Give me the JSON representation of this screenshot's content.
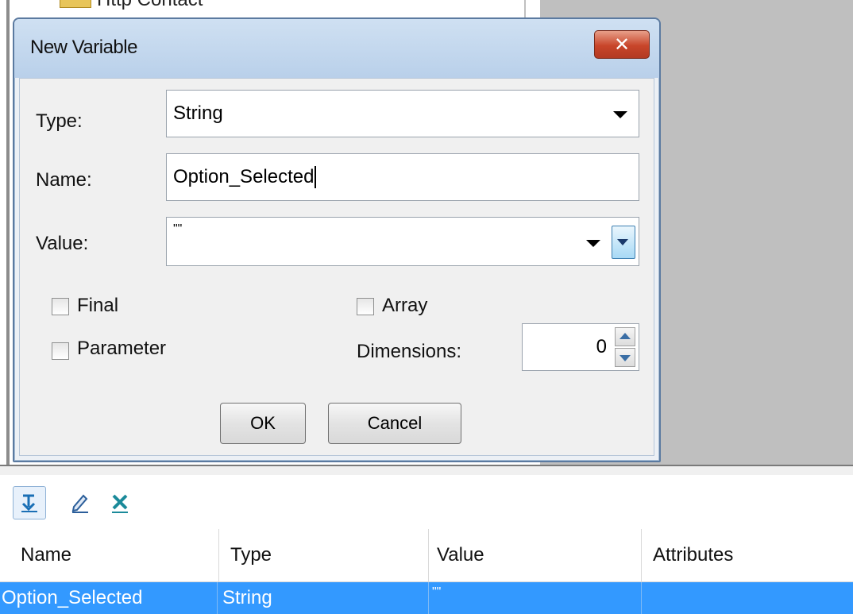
{
  "background": {
    "tree_item_label": "Http Contact"
  },
  "dialog": {
    "title": "New Variable",
    "close_glyph": "✕",
    "type_label": "Type:",
    "type_value": "String",
    "name_label": "Name:",
    "name_value": "Option_Selected",
    "value_label": "Value:",
    "value_value": "\"\"",
    "final_label": "Final",
    "parameter_label": "Parameter",
    "array_label": "Array",
    "dimensions_label": "Dimensions:",
    "dimensions_value": "0",
    "ok_label": "OK",
    "cancel_label": "Cancel"
  },
  "toolbar": {
    "add_icon": "add-variable-icon",
    "edit_icon": "edit-pencil-icon",
    "delete_icon": "delete-x-icon"
  },
  "table": {
    "columns": [
      "Name",
      "Type",
      "Value",
      "Attributes"
    ],
    "rows": [
      [
        "Option_Selected",
        "String",
        "\"\"",
        ""
      ]
    ]
  },
  "colors": {
    "selection": "#3399ff",
    "titlebar": "#cfe0f2",
    "close_button": "#c8452a"
  }
}
